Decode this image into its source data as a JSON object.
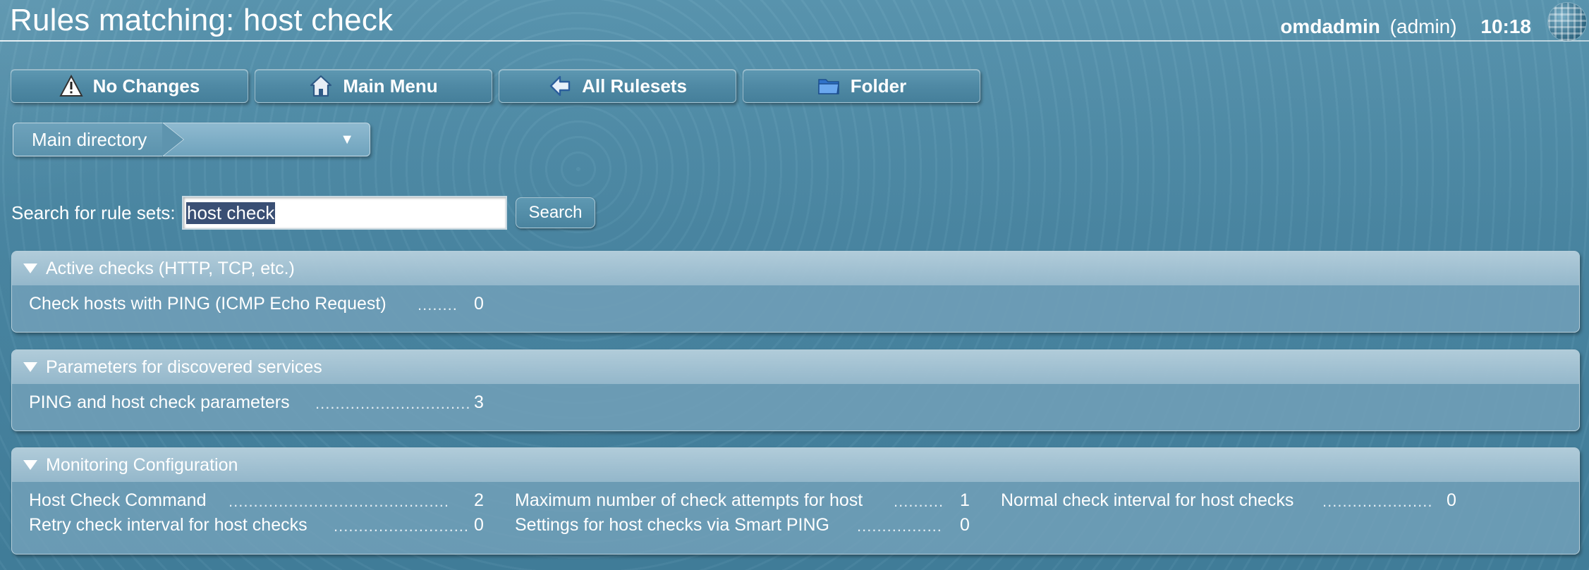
{
  "header": {
    "title": "Rules matching: host check",
    "user_name": "omdadmin",
    "user_role": "(admin)",
    "clock": "10:18"
  },
  "toolbar": {
    "buttons": [
      {
        "label": "No Changes",
        "icon": "warning-icon"
      },
      {
        "label": "Main Menu",
        "icon": "home-icon"
      },
      {
        "label": "All Rulesets",
        "icon": "back-arrow-icon"
      },
      {
        "label": "Folder",
        "icon": "folder-icon"
      }
    ]
  },
  "breadcrumb": {
    "main": "Main directory",
    "dropdown_arrow": "▼"
  },
  "search": {
    "label": "Search for rule sets:",
    "value": "host check",
    "button": "Search"
  },
  "sections": [
    {
      "title": "Active checks (HTTP, TCP, etc.)",
      "rules": [
        {
          "name": "Check hosts with PING (ICMP Echo Request)",
          "dots": "........",
          "count": "0"
        }
      ]
    },
    {
      "title": "Parameters for discovered services",
      "rules": [
        {
          "name": "PING and host check parameters",
          "dots": "...............................",
          "count": "3"
        }
      ]
    },
    {
      "title": "Monitoring Configuration",
      "rules": [
        {
          "name": "Host Check Command",
          "dots": "............................................",
          "count": "2"
        },
        {
          "name": "Maximum number of check attempts for host",
          "dots": "..........",
          "count": "1"
        },
        {
          "name": "Normal check interval for host checks",
          "dots": "......................",
          "count": "0"
        },
        {
          "name": "Retry check interval for host checks",
          "dots": "...........................",
          "count": "0"
        },
        {
          "name": "Settings for host checks via Smart PING",
          "dots": ".................",
          "count": "0"
        }
      ]
    }
  ],
  "colors": {
    "background": "#4d8aa5",
    "section_bg": "#72a0b8",
    "text": "#ffffff"
  }
}
